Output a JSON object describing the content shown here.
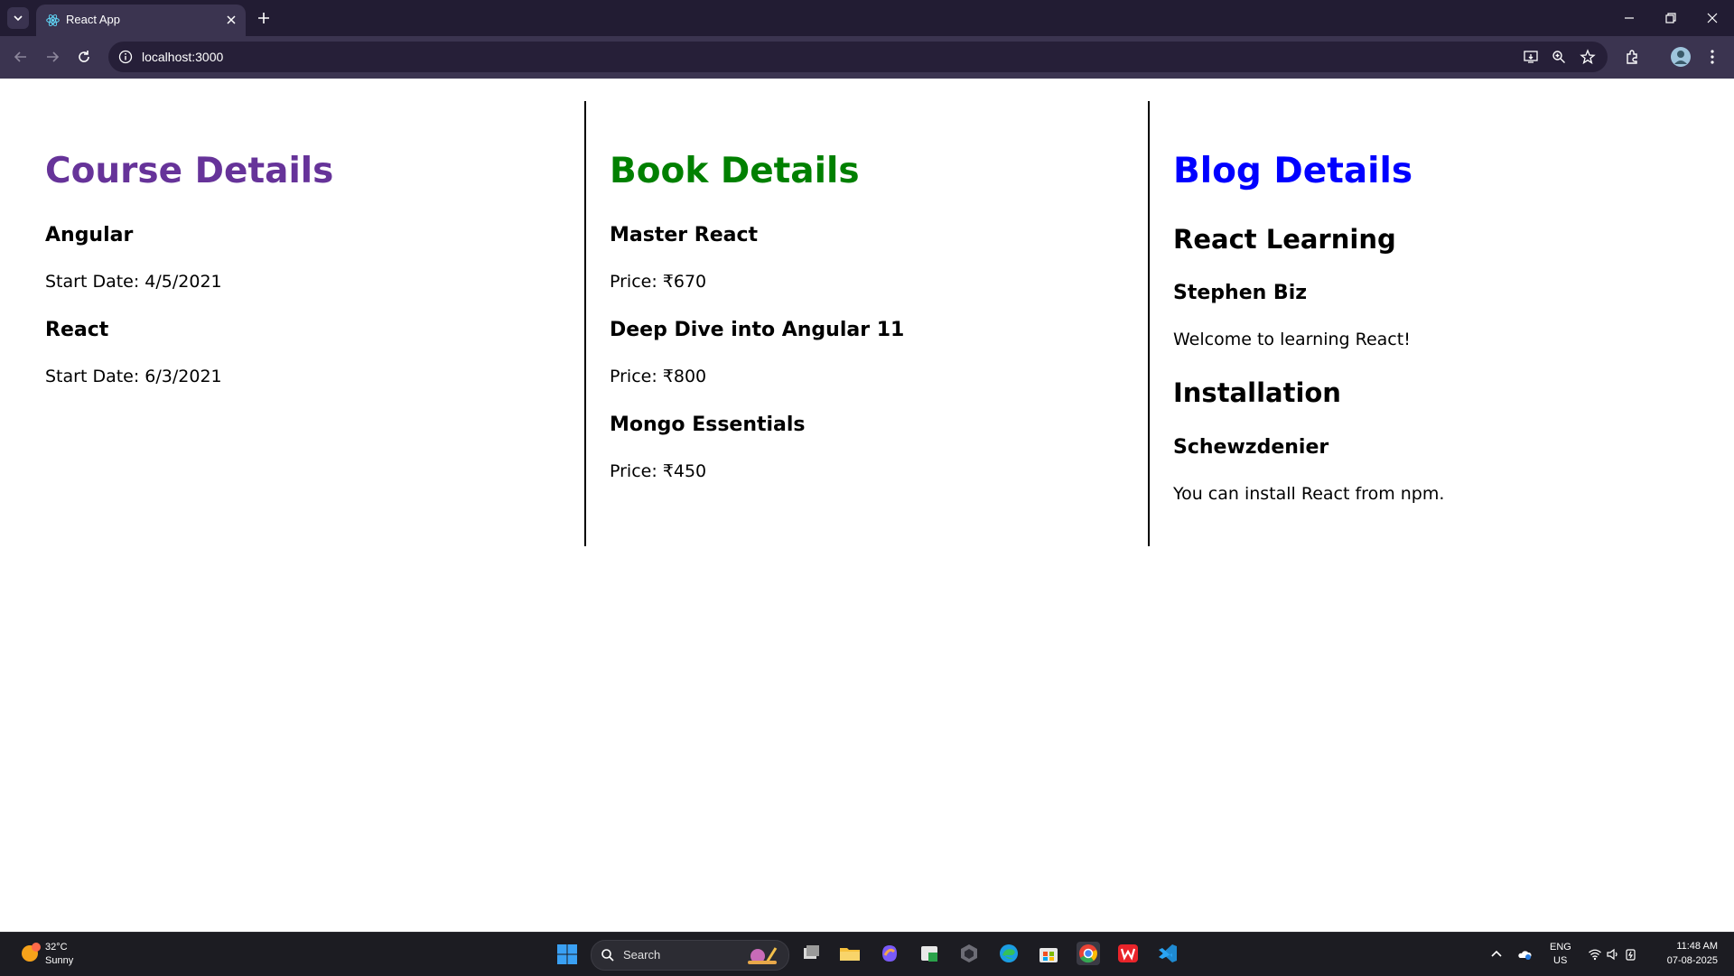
{
  "browser": {
    "tab_title": "React App",
    "url": "localhost:3000"
  },
  "page": {
    "course": {
      "heading": "Course Details",
      "heading_color": "#663399",
      "items": [
        {
          "name": "Angular",
          "date": "Start Date: 4/5/2021"
        },
        {
          "name": "React",
          "date": "Start Date: 6/3/2021"
        }
      ]
    },
    "book": {
      "heading": "Book Details",
      "heading_color": "#008000",
      "items": [
        {
          "name": "Master React",
          "price": "Price: ₹670"
        },
        {
          "name": "Deep Dive into Angular 11",
          "price": "Price: ₹800"
        },
        {
          "name": "Mongo Essentials",
          "price": "Price: ₹450"
        }
      ]
    },
    "blog": {
      "heading": "Blog Details",
      "heading_color": "#0000ff",
      "items": [
        {
          "title": "React Learning",
          "author": "Stephen Biz",
          "text": "Welcome to learning React!"
        },
        {
          "title": "Installation",
          "author": "Schewzdenier",
          "text": "You can install React from npm."
        }
      ]
    }
  },
  "taskbar": {
    "weather_temp": "32°C",
    "weather_cond": "Sunny",
    "search_label": "Search",
    "lang_top": "ENG",
    "lang_bottom": "US",
    "time": "11:48 AM",
    "date": "07-08-2025"
  }
}
